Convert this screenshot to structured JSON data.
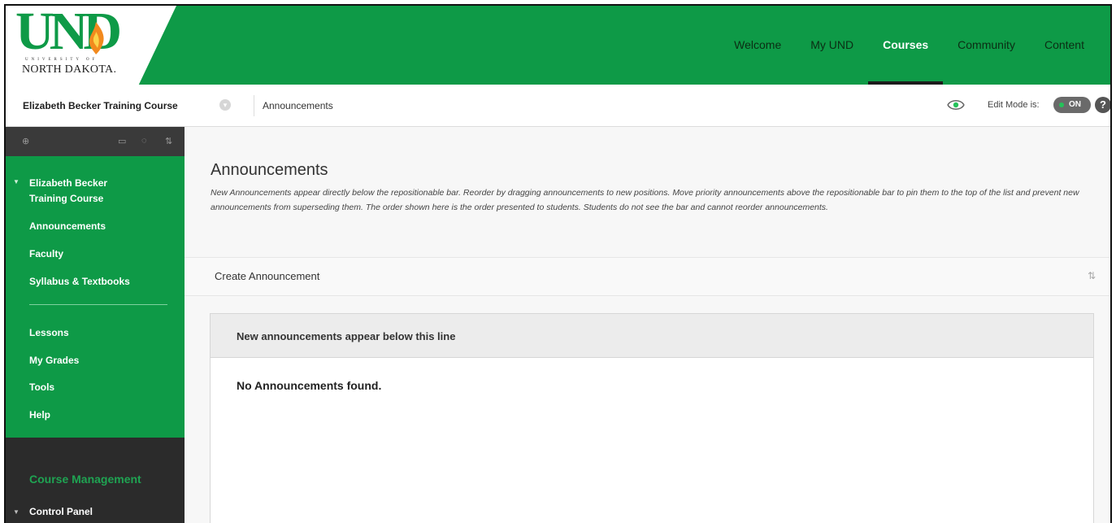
{
  "logo": {
    "wordmark": "UND",
    "university_line": "UNIVERSITY OF",
    "state_line": "NORTH DAKOTA."
  },
  "topnav": {
    "items": [
      {
        "label": "Welcome",
        "active": false
      },
      {
        "label": "My UND",
        "active": false
      },
      {
        "label": "Courses",
        "active": true
      },
      {
        "label": "Community",
        "active": false
      },
      {
        "label": "Content",
        "active": false
      }
    ]
  },
  "breadcrumb": {
    "course": "Elizabeth Becker Training Course",
    "page": "Announcements"
  },
  "editmode": {
    "label": "Edit Mode is:",
    "state": "ON"
  },
  "help": {
    "label": "?"
  },
  "sidebar": {
    "course_title_line1": "Elizabeth Becker",
    "course_title_line2": "Training Course",
    "items_group1": [
      "Announcements",
      "Faculty",
      "Syllabus & Textbooks"
    ],
    "items_group2": [
      "Lessons",
      "My Grades",
      "Tools",
      "Help"
    ],
    "management_title": "Course Management",
    "control_panel": "Control Panel"
  },
  "main": {
    "title": "Announcements",
    "description": "New Announcements appear directly below the repositionable bar. Reorder by dragging announcements to new positions. Move priority announcements above the repositionable bar to pin them to the top of the list and prevent new announcements from superseding them. The order shown here is the order presented to students. Students do not see the bar and cannot reorder announcements.",
    "create_button": "Create Announcement",
    "bar_text": "New announcements appear below this line",
    "empty_text": "No Announcements found."
  },
  "colors": {
    "brand_green": "#0e9a47",
    "sidebar_dark": "#2b2b2b"
  },
  "icons": [
    "flame-icon",
    "chevron-down-icon",
    "eye-icon",
    "toggle-icon",
    "help-icon",
    "add-icon",
    "folder-icon",
    "refresh-icon",
    "reorder-icon"
  ]
}
